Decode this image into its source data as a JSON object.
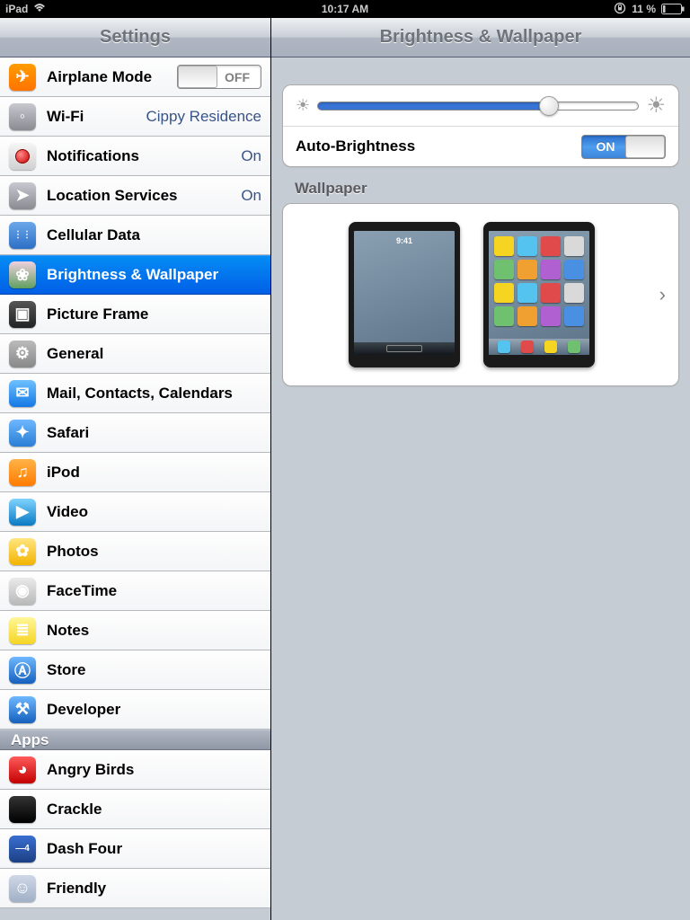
{
  "status": {
    "device": "iPad",
    "time": "10:17 AM",
    "battery_pct": "11 %"
  },
  "sidebar": {
    "title": "Settings",
    "sections": {
      "apps_header": "Apps"
    },
    "items": [
      {
        "label": "Airplane Mode",
        "acc_type": "toggle_off",
        "acc": "OFF",
        "icon": "ic-airplane",
        "glyph": "✈"
      },
      {
        "label": "Wi-Fi",
        "acc": "Cippy Residence",
        "icon": "ic-wifi",
        "glyph": "◦"
      },
      {
        "label": "Notifications",
        "acc": "On",
        "icon": "ic-notif",
        "glyph": ""
      },
      {
        "label": "Location Services",
        "acc": "On",
        "icon": "ic-loc",
        "glyph": "➤"
      },
      {
        "label": "Cellular Data",
        "icon": "ic-cell",
        "glyph": "⋮⋮"
      },
      {
        "label": "Brightness & Wallpaper",
        "icon": "ic-bright",
        "glyph": "❀",
        "selected": true
      },
      {
        "label": "Picture Frame",
        "icon": "ic-pframe",
        "glyph": "▣"
      },
      {
        "label": "General",
        "icon": "ic-gen",
        "glyph": "⚙"
      },
      {
        "label": "Mail, Contacts, Calendars",
        "icon": "ic-mail",
        "glyph": "✉"
      },
      {
        "label": "Safari",
        "icon": "ic-safari",
        "glyph": "✦"
      },
      {
        "label": "iPod",
        "icon": "ic-ipod",
        "glyph": "♫"
      },
      {
        "label": "Video",
        "icon": "ic-video",
        "glyph": "▶"
      },
      {
        "label": "Photos",
        "icon": "ic-photos",
        "glyph": "✿"
      },
      {
        "label": "FaceTime",
        "icon": "ic-ft",
        "glyph": "◉"
      },
      {
        "label": "Notes",
        "icon": "ic-notes",
        "glyph": "≣"
      },
      {
        "label": "Store",
        "icon": "ic-store",
        "glyph": "Ⓐ"
      },
      {
        "label": "Developer",
        "icon": "ic-dev",
        "glyph": "⚒"
      }
    ],
    "app_items": [
      {
        "label": "Angry Birds",
        "icon": "ic-ab",
        "glyph": "◕"
      },
      {
        "label": "Crackle",
        "icon": "ic-crackle",
        "glyph": ""
      },
      {
        "label": "Dash Four",
        "icon": "ic-dash",
        "glyph": "—4"
      },
      {
        "label": "Friendly",
        "icon": "ic-friendly",
        "glyph": "☺"
      }
    ]
  },
  "detail": {
    "title": "Brightness & Wallpaper",
    "brightness_pct": 72,
    "auto_brightness_label": "Auto-Brightness",
    "auto_brightness_value": "ON",
    "wallpaper_label": "Wallpaper",
    "lock_clock": "9:41"
  }
}
